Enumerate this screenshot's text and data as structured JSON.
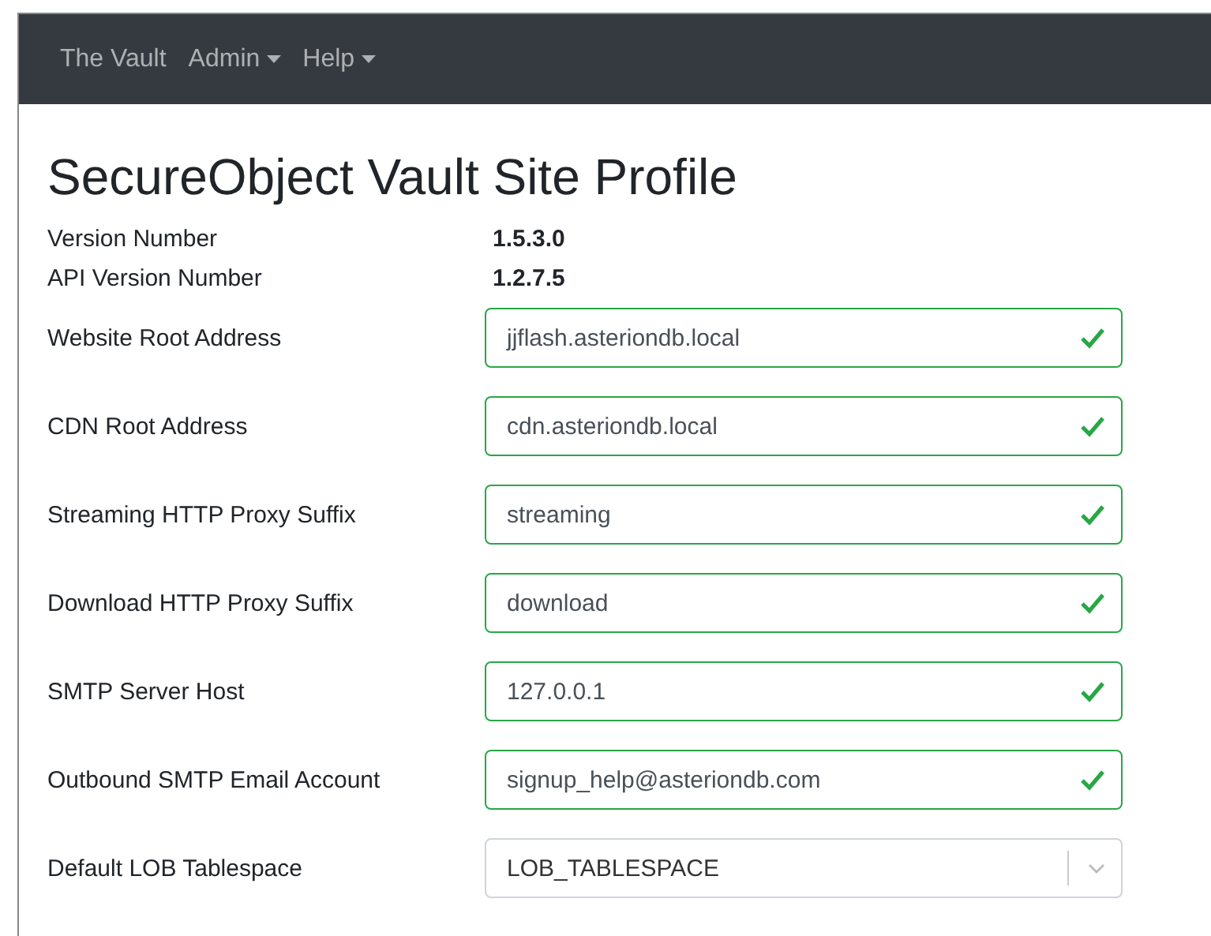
{
  "navbar": {
    "brand": "The Vault",
    "menus": [
      {
        "label": "Admin"
      },
      {
        "label": "Help"
      }
    ]
  },
  "title": "SecureObject Vault Site Profile",
  "info": [
    {
      "label": "Version Number",
      "value": "1.5.3.0"
    },
    {
      "label": "API Version Number",
      "value": "1.2.7.5"
    }
  ],
  "fields": [
    {
      "kind": "text",
      "label": "Website Root Address",
      "value": "jjflash.asteriondb.local",
      "valid": true
    },
    {
      "kind": "text",
      "label": "CDN Root Address",
      "value": "cdn.asteriondb.local",
      "valid": true
    },
    {
      "kind": "text",
      "label": "Streaming HTTP Proxy Suffix",
      "value": "streaming",
      "valid": true
    },
    {
      "kind": "text",
      "label": "Download HTTP Proxy Suffix",
      "value": "download",
      "valid": true
    },
    {
      "kind": "text",
      "label": "SMTP Server Host",
      "value": "127.0.0.1",
      "valid": true
    },
    {
      "kind": "text",
      "label": "Outbound SMTP Email Account",
      "value": "signup_help@asteriondb.com",
      "valid": true
    },
    {
      "kind": "select",
      "label": "Default LOB Tablespace",
      "value": "LOB_TABLESPACE"
    }
  ]
}
